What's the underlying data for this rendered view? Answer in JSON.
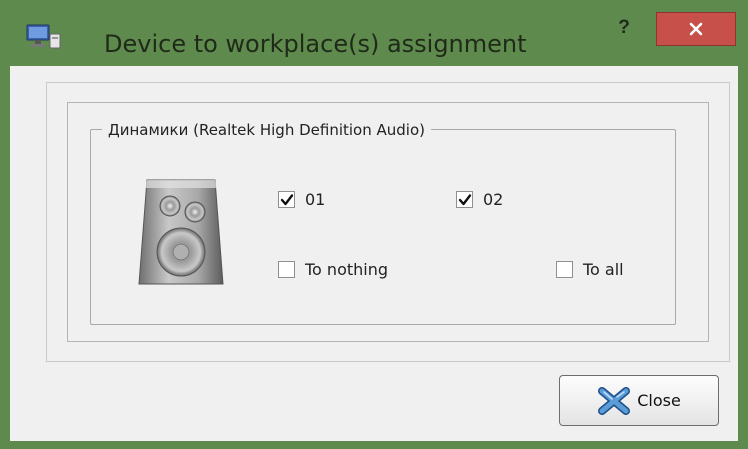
{
  "window": {
    "title": "Device to workplace(s) assignment",
    "help_label": "?",
    "accent_color": "#5f8a4e",
    "close_color": "#c7504b"
  },
  "device_group": {
    "title": "Динамики (Realtek High Definition Audio)",
    "icon": "speaker-icon",
    "checkboxes": [
      {
        "label": "01",
        "checked": true
      },
      {
        "label": "02",
        "checked": true
      },
      {
        "label": "To nothing",
        "checked": false
      },
      {
        "label": "To all",
        "checked": false
      }
    ]
  },
  "footer": {
    "close_label": "Close",
    "close_icon": "x-cross-icon"
  }
}
